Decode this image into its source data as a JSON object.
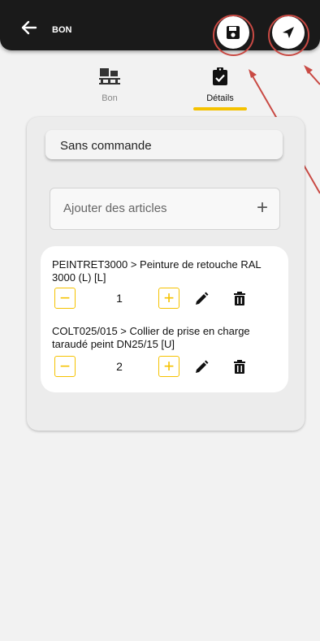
{
  "header": {
    "title": "BON",
    "back_icon": "back-arrow-icon",
    "save_icon": "save-icon",
    "send_icon": "send-icon",
    "annotation_color": "#c94a44"
  },
  "tabs": [
    {
      "label": "Bon",
      "icon": "pallet-icon",
      "active": false
    },
    {
      "label": "Détails",
      "icon": "clipboard-check-icon",
      "active": true
    }
  ],
  "accent": "#f5c200",
  "order": {
    "selected": "Sans commande"
  },
  "add_articles": {
    "placeholder": "Ajouter des articles",
    "plus": "+"
  },
  "items": [
    {
      "title": "PEINTRET3000 > Peinture de retouche RAL 3000 (L) [L]",
      "quantity": "1",
      "minus": "−",
      "plus": "+"
    },
    {
      "title": "COLT025/015 > Collier de prise en charge taraudé peint DN25/15 [U]",
      "quantity": "2",
      "minus": "−",
      "plus": "+"
    }
  ]
}
